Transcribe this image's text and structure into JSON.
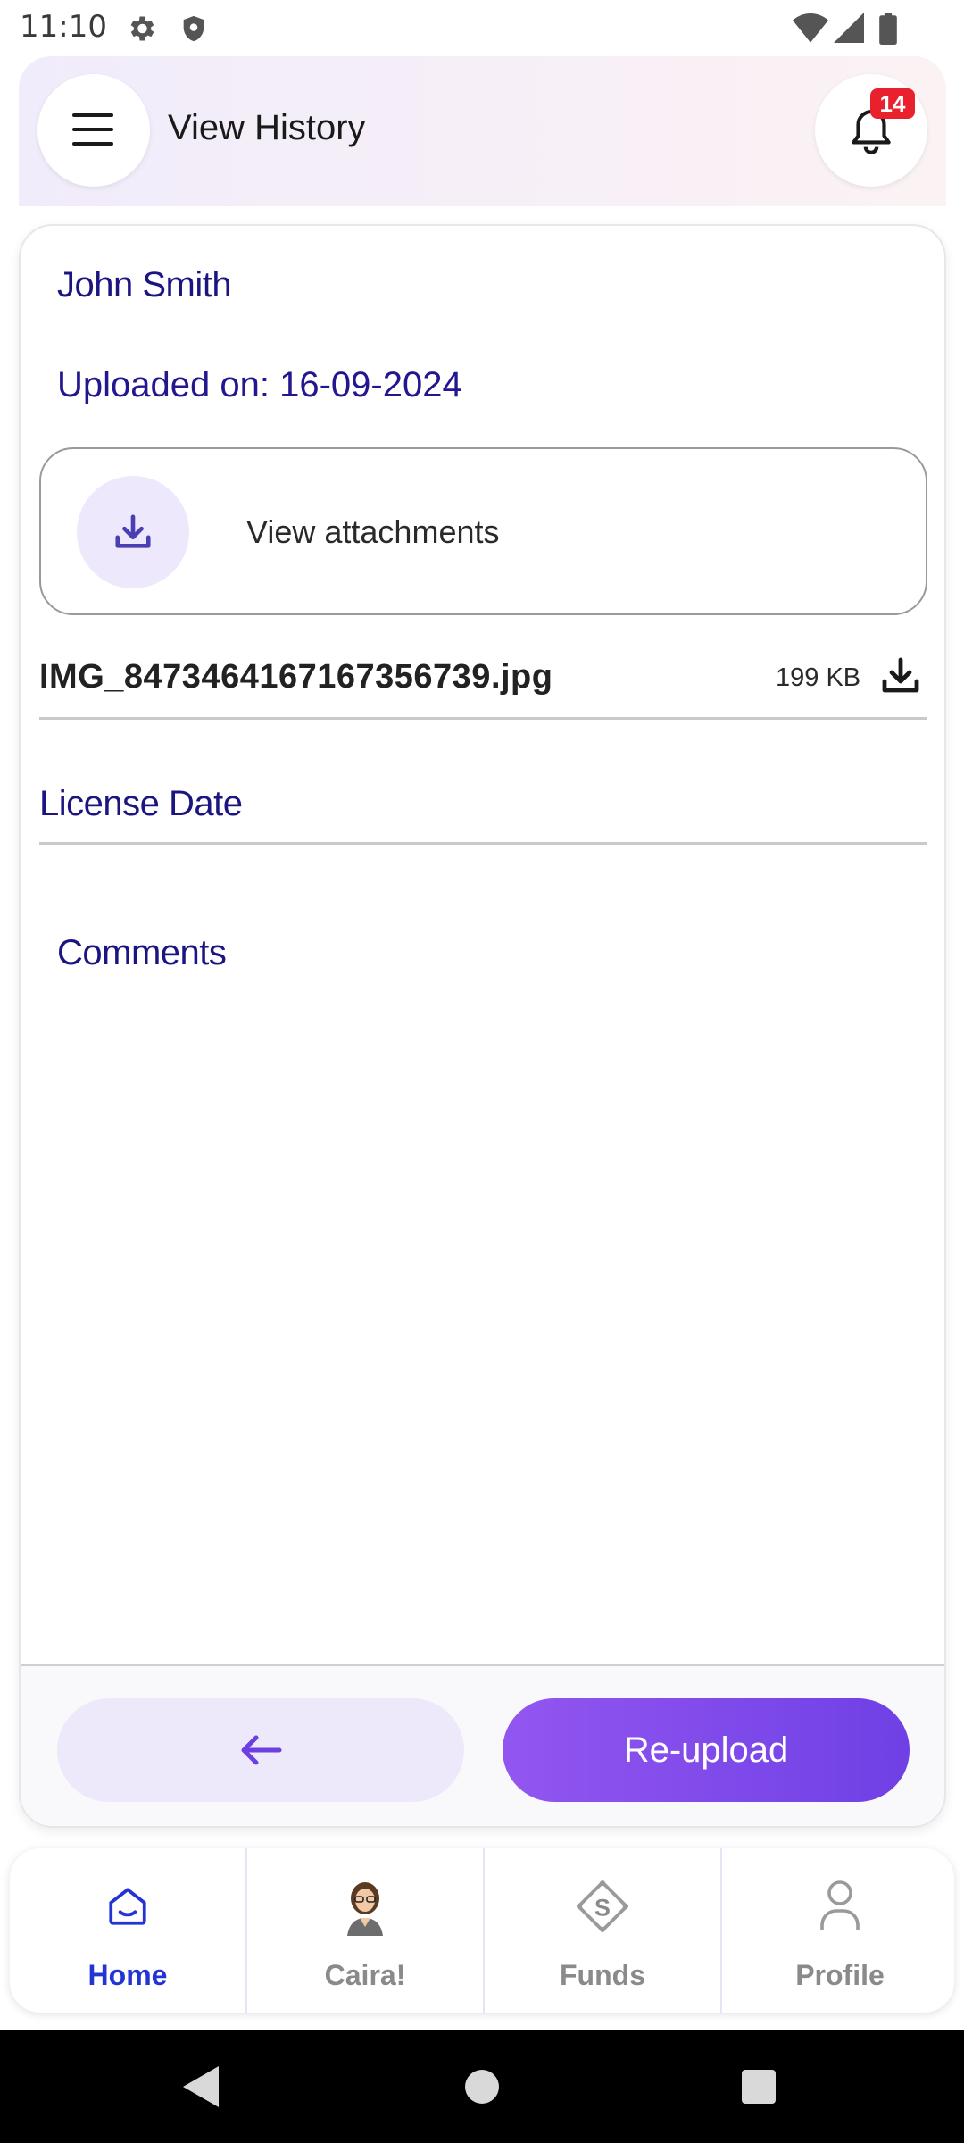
{
  "status_bar": {
    "time": "11:10",
    "icons": [
      "gear-icon",
      "shield-icon",
      "wifi-icon",
      "signal-icon",
      "battery-icon"
    ]
  },
  "header": {
    "title": "View History",
    "notification_count": "14",
    "menu_icon": "hamburger-menu-icon",
    "bell_icon": "bell-icon"
  },
  "details": {
    "name": "John Smith",
    "uploaded_on": "Uploaded on: 16-09-2024",
    "attachments_label": "View attachments",
    "file": {
      "name": "IMG_8473464167167356739.jpg",
      "size": "199 KB"
    },
    "license_date_label": "License Date",
    "comments_label": "Comments"
  },
  "actions": {
    "back_icon": "arrow-left-icon",
    "reupload_label": "Re-upload"
  },
  "bottom_nav": [
    {
      "label": "Home",
      "icon": "home-icon",
      "active": true
    },
    {
      "label": "Caira!",
      "icon": "avatar-icon",
      "active": false
    },
    {
      "label": "Funds",
      "icon": "funds-icon",
      "active": false
    },
    {
      "label": "Profile",
      "icon": "profile-icon",
      "active": false
    }
  ],
  "colors": {
    "primary_purple": "#7b47e9",
    "heading_navy": "#1b1582",
    "active_nav_blue": "#2433d4",
    "badge_red": "#e8212d"
  }
}
